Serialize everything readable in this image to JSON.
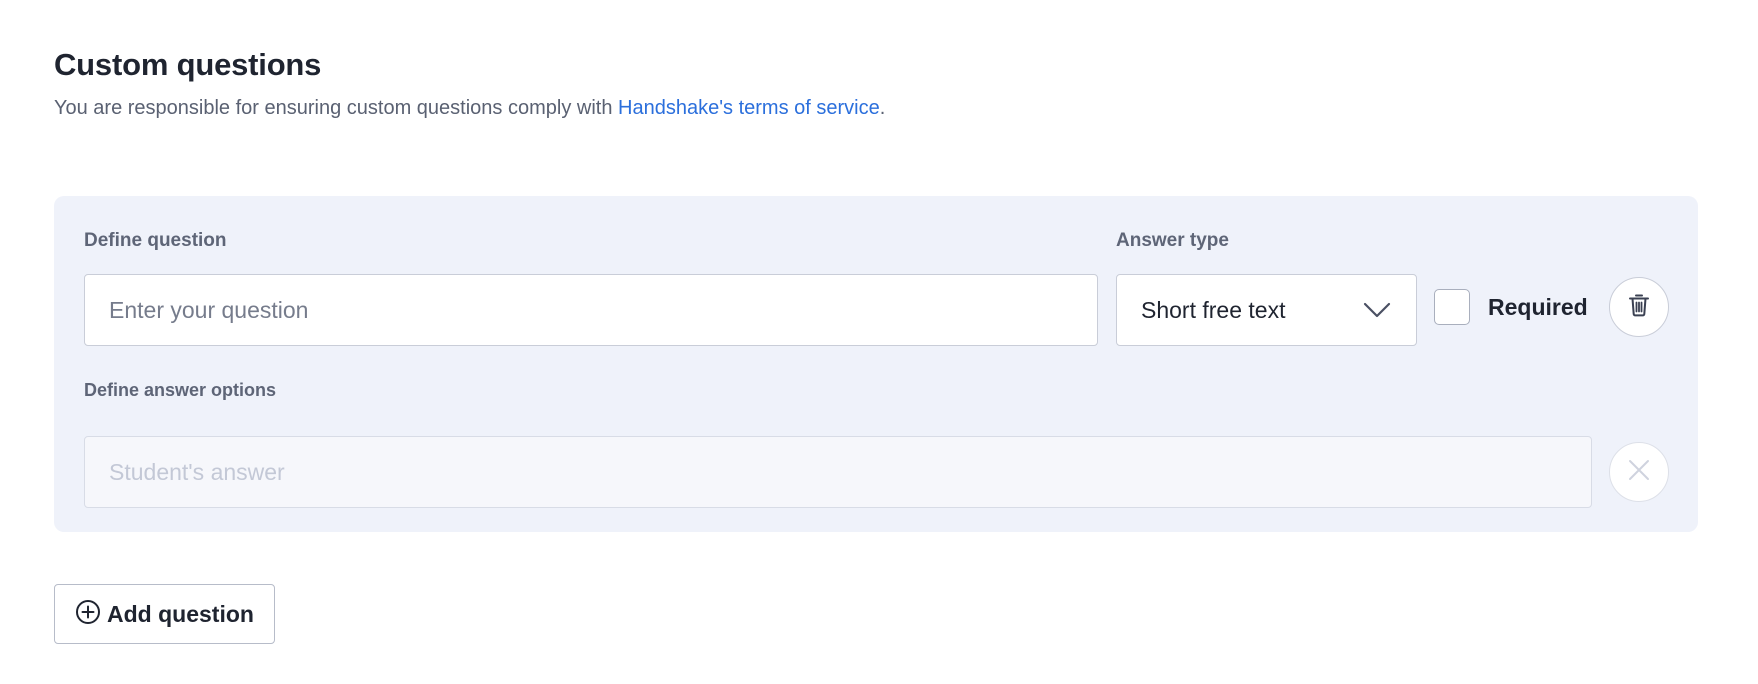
{
  "header": {
    "title": "Custom questions",
    "subtitle_prefix": "You are responsible for ensuring custom questions comply with ",
    "terms_link": "Handshake's terms of service",
    "subtitle_suffix": "."
  },
  "question_card": {
    "define_question_label": "Define question",
    "question_placeholder": "Enter your question",
    "question_value": "",
    "answer_type_label": "Answer type",
    "answer_type_value": "Short free text",
    "required_label": "Required",
    "required_checked": false,
    "define_answer_options_label": "Define answer options",
    "answer_placeholder": "Student's answer"
  },
  "actions": {
    "add_question_label": "Add question"
  },
  "icons": {
    "chevron": "chevron-down-icon",
    "delete": "trash-icon",
    "remove": "close-icon",
    "add": "plus-circle-icon"
  },
  "colors": {
    "link": "#2b6fdc",
    "card_bg": "#eff2fa",
    "text_primary": "#1f2430",
    "text_muted": "#5e6577"
  }
}
